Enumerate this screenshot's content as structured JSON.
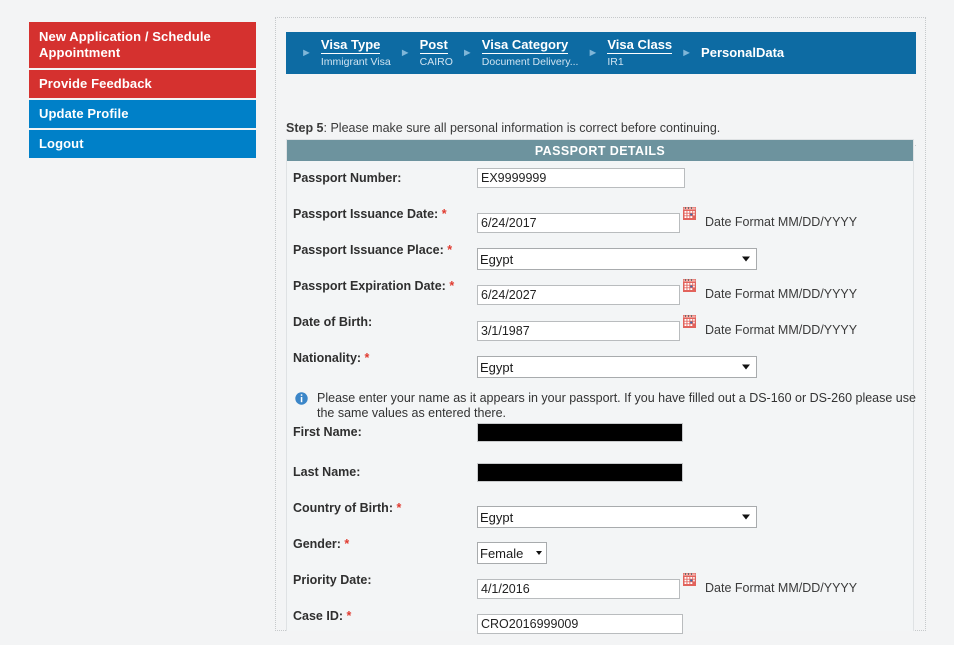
{
  "sidebar": {
    "items": [
      {
        "label": "New Application / Schedule Appointment",
        "style": "red"
      },
      {
        "label": "Provide Feedback",
        "style": "red"
      },
      {
        "label": "Update Profile",
        "style": "blue"
      },
      {
        "label": "Logout",
        "style": "blue"
      }
    ]
  },
  "breadcrumb": {
    "items": [
      {
        "title": "Visa Type",
        "sub": "Immigrant Visa"
      },
      {
        "title": "Post",
        "sub": "CAIRO"
      },
      {
        "title": "Visa Category",
        "sub": "Document Delivery..."
      },
      {
        "title": "Visa Class",
        "sub": "IR1"
      },
      {
        "title": "PersonalData",
        "sub": ""
      }
    ],
    "arrow_icon": "chevron-right-icon"
  },
  "step": {
    "prefix": "Step 5",
    "text": ": Please make sure all personal information is correct before continuing."
  },
  "form": {
    "section_title": "PASSPORT DETAILS",
    "date_format_hint": "Date Format MM/DD/YYYY",
    "note": "Please enter your name as it appears in your passport. If you have filled out a DS-160 or DS-260 please use the same values as entered there.",
    "note_icon": "info-icon",
    "calendar_icon": "calendar-icon",
    "fields": {
      "passport_number": {
        "label": "Passport Number:",
        "value": "EX9999999",
        "required": false
      },
      "passport_issuance_date": {
        "label": "Passport Issuance Date:",
        "value": "6/24/2017",
        "required": true
      },
      "passport_issuance_place": {
        "label": "Passport Issuance Place:",
        "value": "Egypt",
        "required": true
      },
      "passport_expiration_date": {
        "label": "Passport Expiration Date:",
        "value": "6/24/2027",
        "required": true
      },
      "date_of_birth": {
        "label": "Date of Birth:",
        "value": "3/1/1987",
        "required": false
      },
      "nationality": {
        "label": "Nationality:",
        "value": "Egypt",
        "required": true
      },
      "first_name": {
        "label": "First Name:",
        "value": "",
        "redacted": true,
        "required": false
      },
      "last_name": {
        "label": "Last Name:",
        "value": "",
        "redacted": true,
        "required": false
      },
      "country_of_birth": {
        "label": "Country of Birth:",
        "value": "Egypt",
        "required": true
      },
      "gender": {
        "label": "Gender:",
        "value": "Female",
        "required": true
      },
      "priority_date": {
        "label": "Priority Date:",
        "value": "4/1/2016",
        "required": false
      },
      "case_id": {
        "label": "Case ID:",
        "value": "CRO2016999009",
        "required": true
      }
    }
  },
  "colors": {
    "nav_red": "#d5312f",
    "nav_blue": "#0080c8",
    "breadcrumb_blue": "#0d6ba3",
    "section_teal": "#6d939e",
    "required_red": "#e03a2f",
    "page_bg": "#f3f4f5"
  }
}
